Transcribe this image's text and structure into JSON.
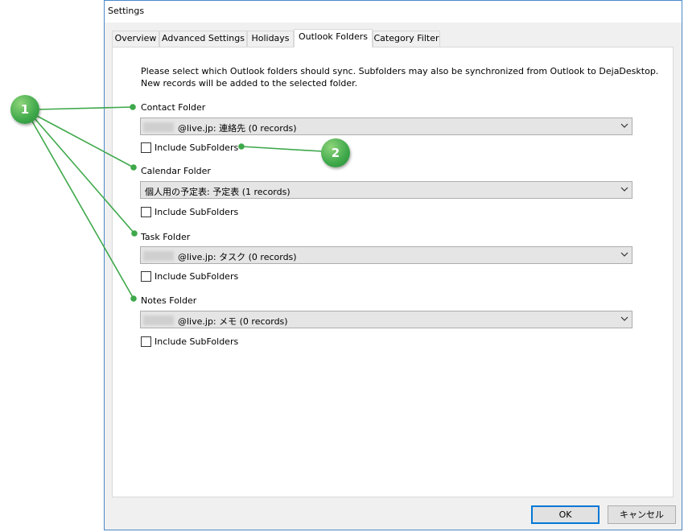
{
  "window": {
    "title": "Settings"
  },
  "tabs": [
    {
      "label": "Overview"
    },
    {
      "label": "Advanced Settings"
    },
    {
      "label": "Holidays"
    },
    {
      "label": "Outlook Folders"
    },
    {
      "label": "Category Filter"
    }
  ],
  "description": {
    "line1": "Please select which Outlook folders should sync.  Subfolders may also be synchronized from Outlook to DejaDesktop.",
    "line2": "New records will be added to the selected folder."
  },
  "folders": [
    {
      "label": "Contact Folder",
      "selected": "@live.jp: 連絡先 (0 records)",
      "subfolders_label": "Include SubFolders",
      "subfolders_checked": false
    },
    {
      "label": "Calendar Folder",
      "selected": "個人用の予定表: 予定表 (1 records)",
      "subfolders_label": "Include SubFolders",
      "subfolders_checked": false
    },
    {
      "label": "Task Folder",
      "selected": "@live.jp: タスク (0 records)",
      "subfolders_label": "Include SubFolders",
      "subfolders_checked": false
    },
    {
      "label": "Notes Folder",
      "selected": "@live.jp: メモ (0 records)",
      "subfolders_label": "Include SubFolders",
      "subfolders_checked": false
    }
  ],
  "buttons": {
    "ok": "OK",
    "cancel": "キャンセル"
  },
  "callouts": {
    "one": "1",
    "two": "2"
  },
  "colors": {
    "callout_green": "#3ea84a",
    "window_border": "#4a88c8",
    "accent": "#0078d7"
  },
  "icons": {
    "dropdown": "chevron-down-icon"
  }
}
